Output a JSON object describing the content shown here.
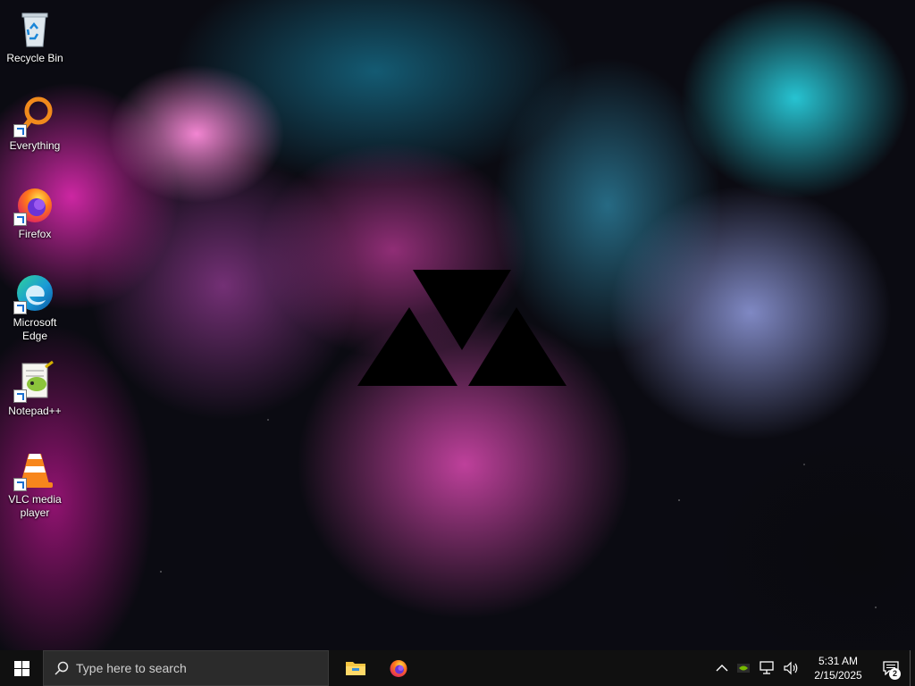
{
  "desktop": {
    "icons": [
      {
        "label": "Recycle Bin",
        "icon": "recycle-bin-icon"
      },
      {
        "label": "Everything",
        "icon": "everything-search-icon"
      },
      {
        "label": "Firefox",
        "icon": "firefox-icon"
      },
      {
        "label": "Microsoft Edge",
        "icon": "edge-icon"
      },
      {
        "label": "Notepad++",
        "icon": "notepad-plus-plus-icon"
      },
      {
        "label": "VLC media player",
        "icon": "vlc-icon"
      }
    ],
    "wallpaper_logo": "triangle-logo"
  },
  "taskbar": {
    "search_placeholder": "Type here to search",
    "pinned_apps": [
      "file-explorer-icon",
      "firefox-icon"
    ],
    "tray": {
      "time": "5:31 AM",
      "date": "2/15/2025",
      "notification_count": "2"
    }
  },
  "colors": {
    "taskbar_bg": "#101010",
    "search_bg": "#2b2b2b",
    "accent_blue": "#0078d7"
  }
}
